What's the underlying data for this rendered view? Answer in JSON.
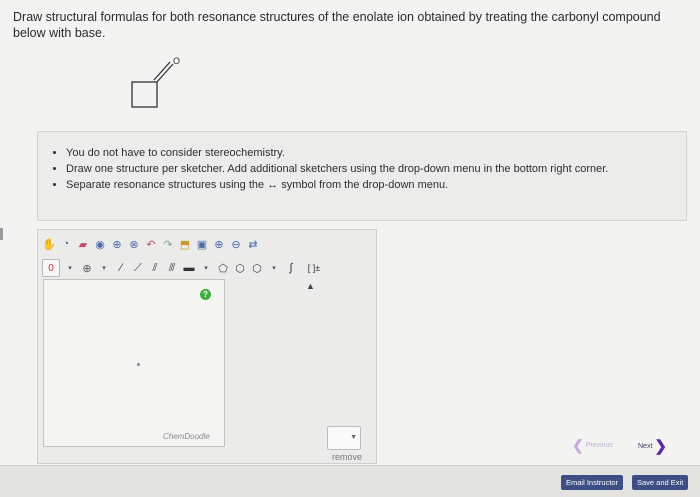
{
  "question": {
    "text": "Draw structural formulas for both resonance structures of the enolate ion obtained by treating the carbonyl compound below with base."
  },
  "molecule": {
    "atom_label": "O"
  },
  "instructions": {
    "items": [
      "You do not have to consider stereochemistry.",
      "Draw one structure per sketcher. Add additional sketchers using the drop-down menu in the bottom right corner.",
      "Separate resonance structures using the ↔ symbol from the drop-down menu."
    ]
  },
  "sketcher": {
    "charge_value": "0",
    "bracket_label": "[ ]±",
    "help_symbol": "?",
    "brand": "ChemDoodle"
  },
  "controls": {
    "remove_label": "remove",
    "previous_label": "Previous",
    "next_label": "Next"
  },
  "footer": {
    "email_label": "Email Instructor",
    "save_label": "Save and Exit"
  },
  "colors": {
    "button_bg": "#3e4d84",
    "next_arrow": "#5b2aa8",
    "help_green": "#3fae3f"
  }
}
